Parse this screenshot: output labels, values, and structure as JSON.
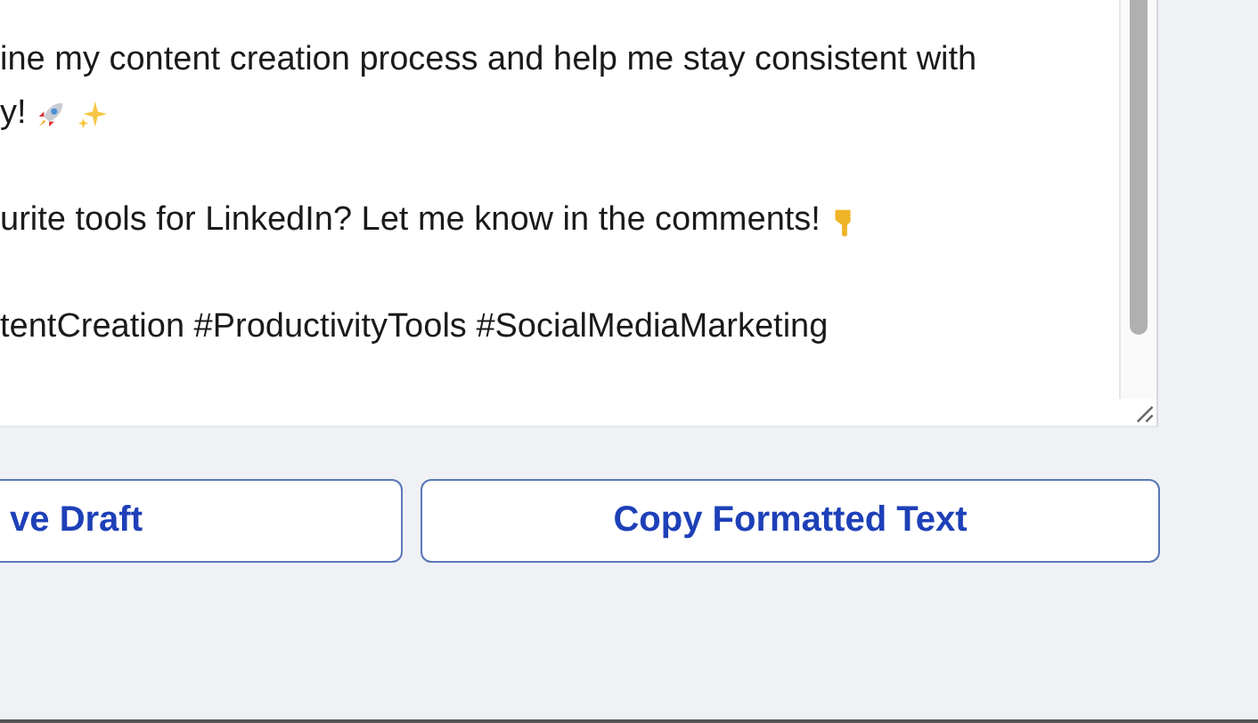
{
  "editor": {
    "paragraphs": [
      [
        "ine my content creation process and help me stay consistent with",
        "y!"
      ],
      [
        "urite tools for LinkedIn? Let me know in the comments!"
      ],
      [
        "tentCreation #ProductivityTools #SocialMediaMarketing"
      ]
    ]
  },
  "buttons": [
    {
      "label": "ve Draft",
      "kind": "cut"
    },
    {
      "label": "Copy Formatted Text",
      "kind": "full"
    }
  ]
}
